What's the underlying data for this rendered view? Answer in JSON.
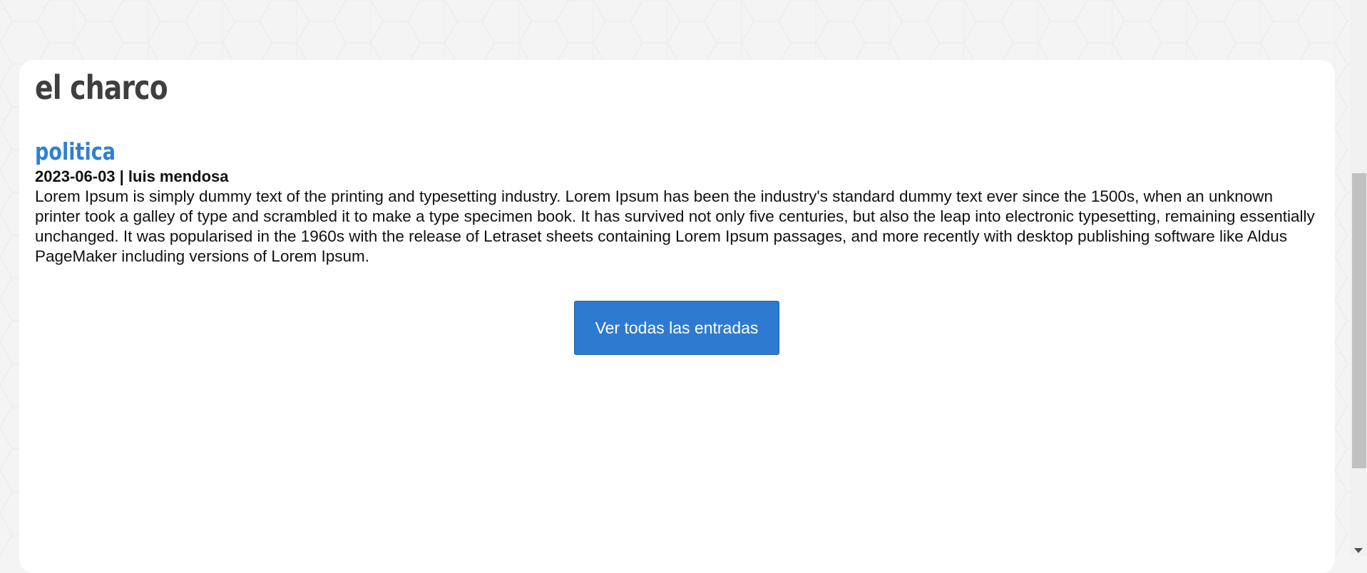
{
  "site": {
    "title": "el charco"
  },
  "post": {
    "category": "politica",
    "meta": "2023-06-03 | luis mendosa",
    "body": "Lorem Ipsum is simply dummy text of the printing and typesetting industry. Lorem Ipsum has been the industry's standard dummy text ever since the 1500s, when an unknown printer took a galley of type and scrambled it to make a type specimen book. It has survived not only five centuries, but also the leap into electronic typesetting, remaining essentially unchanged. It was popularised in the 1960s with the release of Letraset sheets containing Lorem Ipsum passages, and more recently with desktop publishing software like Aldus PageMaker including versions of Lorem Ipsum."
  },
  "actions": {
    "view_all_label": "Ver todas las entradas"
  },
  "colors": {
    "accent": "#2f80d0",
    "button": "#2e7ad0",
    "title": "#3f3f3f",
    "page_background": "#f4f4f4"
  },
  "icons": {
    "scroll_down": "chevron-down-icon"
  }
}
